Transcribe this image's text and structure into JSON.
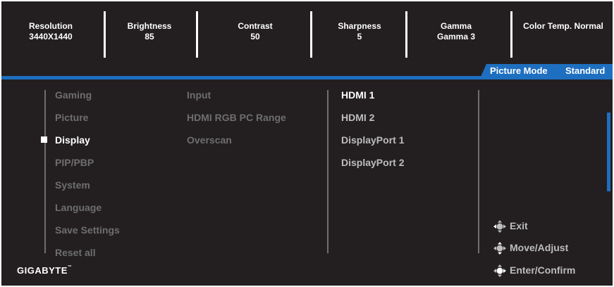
{
  "header": {
    "items": [
      {
        "label": "Resolution",
        "value": "3440X1440"
      },
      {
        "label": "Brightness",
        "value": "85"
      },
      {
        "label": "Contrast",
        "value": "50"
      },
      {
        "label": "Sharpness",
        "value": "5"
      },
      {
        "label": "Gamma",
        "value": "Gamma 3"
      },
      {
        "label": "Color Temp. Normal",
        "value": ""
      }
    ]
  },
  "picture_mode": {
    "label": "Picture Mode",
    "value": "Standard"
  },
  "menu": {
    "items": [
      "Gaming",
      "Picture",
      "Display",
      "PIP/PBP",
      "System",
      "Language",
      "Save Settings",
      "Reset all"
    ],
    "selected_index": 2
  },
  "submenu": {
    "items": [
      "Input",
      "HDMI RGB PC Range",
      "Overscan"
    ]
  },
  "inputs": {
    "items": [
      "HDMI 1",
      "HDMI 2",
      "DisplayPort 1",
      "DisplayPort 2"
    ],
    "selected_index": 0
  },
  "hints": {
    "exit": "Exit",
    "move": "Move/Adjust",
    "enter": "Enter/Confirm"
  },
  "brand": {
    "logo": "GIGABYTE",
    "tm": "™"
  },
  "colors": {
    "accent": "#1e6fc0",
    "background": "#231f20",
    "inactive": "#6e6e6e",
    "active": "#ffffff"
  },
  "icons": {
    "joystick": "joystick-icon"
  }
}
